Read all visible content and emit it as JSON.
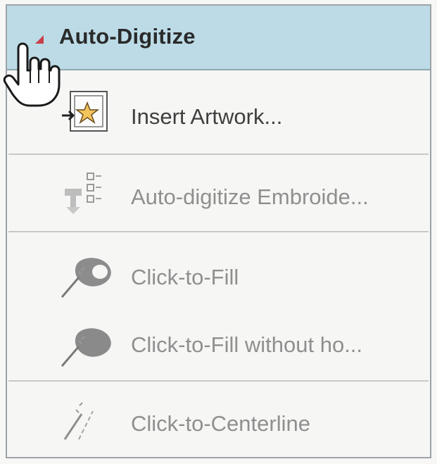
{
  "group": {
    "title": "Auto-Digitize",
    "accent_color": "#bcdbe6",
    "collapse_indicator_color": "#c8404b"
  },
  "items": [
    {
      "label": "Insert Artwork...",
      "icon": "insert-artwork-icon",
      "enabled": true
    },
    {
      "label": "Auto-digitize Embroide...",
      "icon": "auto-digitize-embroidery-icon",
      "enabled": false
    },
    {
      "label": "Click-to-Fill",
      "icon": "click-to-fill-icon",
      "enabled": false
    },
    {
      "label": "Click-to-Fill without ho...",
      "icon": "click-to-fill-without-holes-icon",
      "enabled": false
    },
    {
      "label": "Click-to-Centerline",
      "icon": "click-to-centerline-icon",
      "enabled": false
    }
  ]
}
